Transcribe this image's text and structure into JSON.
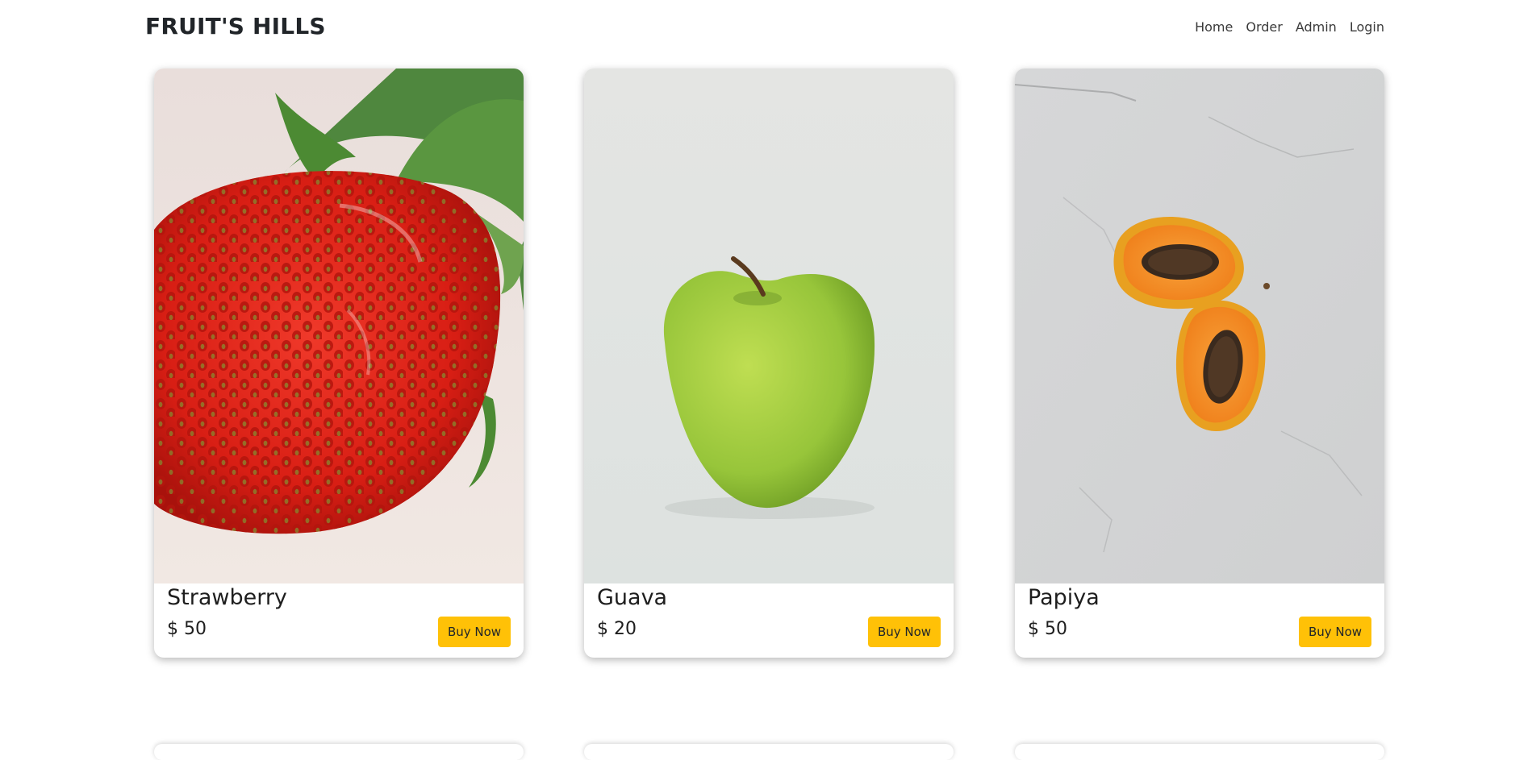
{
  "header": {
    "brand": "FRUIT'S HILLS",
    "nav": [
      "Home",
      "Order",
      "Admin",
      "Login"
    ]
  },
  "products": [
    {
      "name": "Strawberry",
      "price": "$ 50",
      "button": "Buy Now"
    },
    {
      "name": "Guava",
      "price": "$ 20",
      "button": "Buy Now"
    },
    {
      "name": "Papiya",
      "price": "$ 50",
      "button": "Buy Now"
    }
  ],
  "colors": {
    "accent": "#ffc107",
    "text": "#212529",
    "background": "#ffffff"
  }
}
